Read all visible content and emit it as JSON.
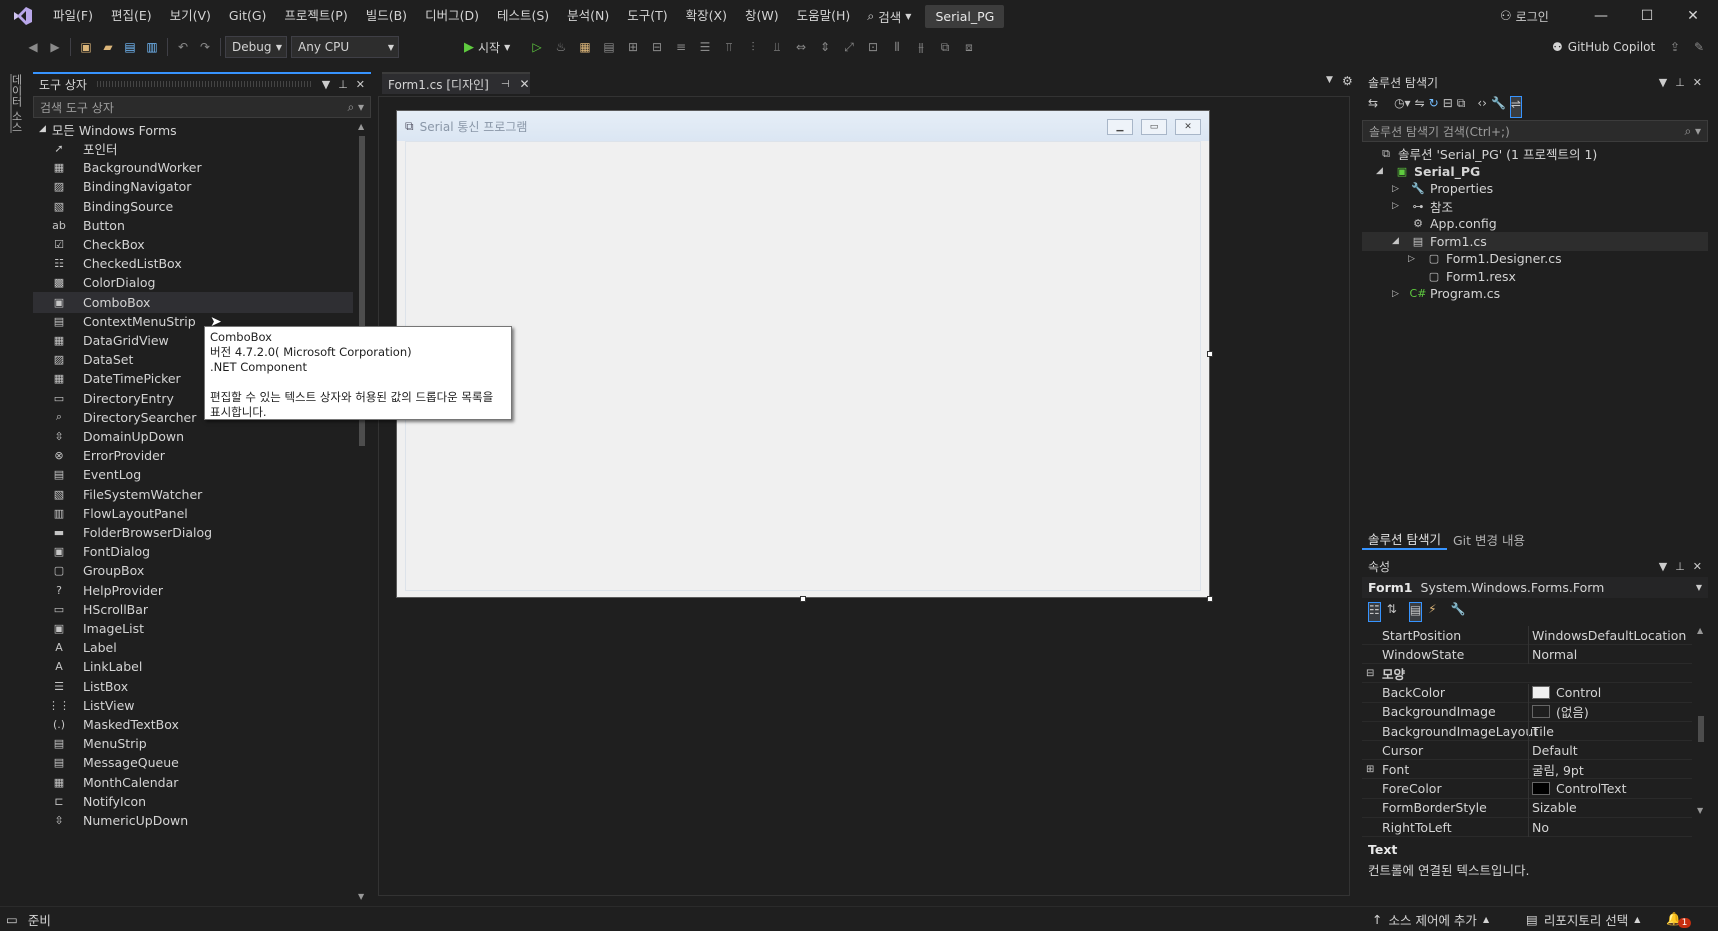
{
  "menu": {
    "items": [
      "파일(F)",
      "편집(E)",
      "보기(V)",
      "Git(G)",
      "프로젝트(P)",
      "빌드(B)",
      "디버그(D)",
      "테스트(S)",
      "분석(N)",
      "도구(T)",
      "확장(X)",
      "창(W)",
      "도움말(H)"
    ],
    "search": "검색",
    "solution_name": "Serial_PG",
    "login": "로그인"
  },
  "toolbar": {
    "config": "Debug",
    "platform": "Any CPU",
    "start": "시작",
    "copilot": "GitHub Copilot"
  },
  "left_strip": {
    "label": "데이터 소스"
  },
  "toolbox": {
    "title": "도구 상자",
    "search_placeholder": "검색 도구 상자",
    "group": "모든 Windows Forms",
    "items": [
      {
        "label": "포인터",
        "icon": "pointer-icon"
      },
      {
        "label": "BackgroundWorker",
        "icon": "backgroundworker-icon"
      },
      {
        "label": "BindingNavigator",
        "icon": "bindingnavigator-icon"
      },
      {
        "label": "BindingSource",
        "icon": "bindingsource-icon"
      },
      {
        "label": "Button",
        "icon": "button-icon"
      },
      {
        "label": "CheckBox",
        "icon": "checkbox-icon"
      },
      {
        "label": "CheckedListBox",
        "icon": "checkedlistbox-icon"
      },
      {
        "label": "ColorDialog",
        "icon": "colordialog-icon"
      },
      {
        "label": "ComboBox",
        "icon": "combobox-icon"
      },
      {
        "label": "ContextMenuStrip",
        "icon": "contextmenustrip-icon"
      },
      {
        "label": "DataGridView",
        "icon": "datagridview-icon"
      },
      {
        "label": "DataSet",
        "icon": "dataset-icon"
      },
      {
        "label": "DateTimePicker",
        "icon": "datetimepicker-icon"
      },
      {
        "label": "DirectoryEntry",
        "icon": "directoryentry-icon"
      },
      {
        "label": "DirectorySearcher",
        "icon": "directorysearcher-icon"
      },
      {
        "label": "DomainUpDown",
        "icon": "domainupdown-icon"
      },
      {
        "label": "ErrorProvider",
        "icon": "errorprovider-icon"
      },
      {
        "label": "EventLog",
        "icon": "eventlog-icon"
      },
      {
        "label": "FileSystemWatcher",
        "icon": "filesystemwatcher-icon"
      },
      {
        "label": "FlowLayoutPanel",
        "icon": "flowlayoutpanel-icon"
      },
      {
        "label": "FolderBrowserDialog",
        "icon": "folderbrowserdialog-icon"
      },
      {
        "label": "FontDialog",
        "icon": "fontdialog-icon"
      },
      {
        "label": "GroupBox",
        "icon": "groupbox-icon"
      },
      {
        "label": "HelpProvider",
        "icon": "helpprovider-icon"
      },
      {
        "label": "HScrollBar",
        "icon": "hscrollbar-icon"
      },
      {
        "label": "ImageList",
        "icon": "imagelist-icon"
      },
      {
        "label": "Label",
        "icon": "label-icon"
      },
      {
        "label": "LinkLabel",
        "icon": "linklabel-icon"
      },
      {
        "label": "ListBox",
        "icon": "listbox-icon"
      },
      {
        "label": "ListView",
        "icon": "listview-icon"
      },
      {
        "label": "MaskedTextBox",
        "icon": "maskedtextbox-icon"
      },
      {
        "label": "MenuStrip",
        "icon": "menustrip-icon"
      },
      {
        "label": "MessageQueue",
        "icon": "messagequeue-icon"
      },
      {
        "label": "MonthCalendar",
        "icon": "monthcalendar-icon"
      },
      {
        "label": "NotifyIcon",
        "icon": "notifyicon-icon"
      },
      {
        "label": "NumericUpDown",
        "icon": "numericupdown-icon"
      }
    ],
    "selected": "ComboBox"
  },
  "tooltip": {
    "name": "ComboBox",
    "version": "버전 4.7.2.0( Microsoft Corporation)",
    "kind": ".NET Component",
    "description": "편집할 수 있는 텍스트 상자와 허용된 값의 드롭다운 목록을 표시합니다."
  },
  "document": {
    "tab_label": "Form1.cs [디자인]",
    "form_title": "Serial 통신 프로그램"
  },
  "solution_explorer": {
    "title": "솔루션 탐색기",
    "search_placeholder": "솔루션 탐색기 검색(Ctrl+;)",
    "nodes": [
      {
        "label": "솔루션 'Serial_PG' (1 프로젝트의 1)",
        "icon": "solution-icon"
      },
      {
        "label": "Serial_PG",
        "icon": "csharp-project-icon"
      },
      {
        "label": "Properties",
        "icon": "wrench-icon"
      },
      {
        "label": "참조",
        "icon": "references-icon"
      },
      {
        "label": "App.config",
        "icon": "config-file-icon"
      },
      {
        "label": "Form1.cs",
        "icon": "form-icon"
      },
      {
        "label": "Form1.Designer.cs",
        "icon": "file-icon"
      },
      {
        "label": "Form1.resx",
        "icon": "file-icon"
      },
      {
        "label": "Program.cs",
        "icon": "csharp-file-icon"
      }
    ],
    "tabs": [
      "솔루션 탐색기",
      "Git 변경 내용"
    ]
  },
  "properties": {
    "title": "속성",
    "object": "Form1",
    "object_type": "System.Windows.Forms.Form",
    "rows": [
      {
        "name": "StartPosition",
        "value": "WindowsDefaultLocation"
      },
      {
        "name": "WindowState",
        "value": "Normal"
      }
    ],
    "category": "모양",
    "category_rows": [
      {
        "name": "BackColor",
        "value": "Control",
        "swatch": "#f0f0f0"
      },
      {
        "name": "BackgroundImage",
        "value": "(없음)",
        "swatch": "#1f1f1f"
      },
      {
        "name": "BackgroundImageLayout",
        "value": "Tile"
      },
      {
        "name": "Cursor",
        "value": "Default"
      },
      {
        "name": "Font",
        "value": "굴림, 9pt"
      },
      {
        "name": "ForeColor",
        "value": "ControlText",
        "swatch": "#000000"
      },
      {
        "name": "FormBorderStyle",
        "value": "Sizable"
      },
      {
        "name": "RightToLeft",
        "value": "No"
      }
    ],
    "desc_title": "Text",
    "desc_text": "컨트롤에 연결된 텍스트입니다."
  },
  "statusbar": {
    "ready": "준비",
    "source_control": "소스 제어에 추가",
    "repository": "리포지토리 선택",
    "notifications": "1"
  },
  "colors": {
    "accent": "#3794ff",
    "background": "#1f1f1f",
    "selected": "#2f2f33"
  }
}
